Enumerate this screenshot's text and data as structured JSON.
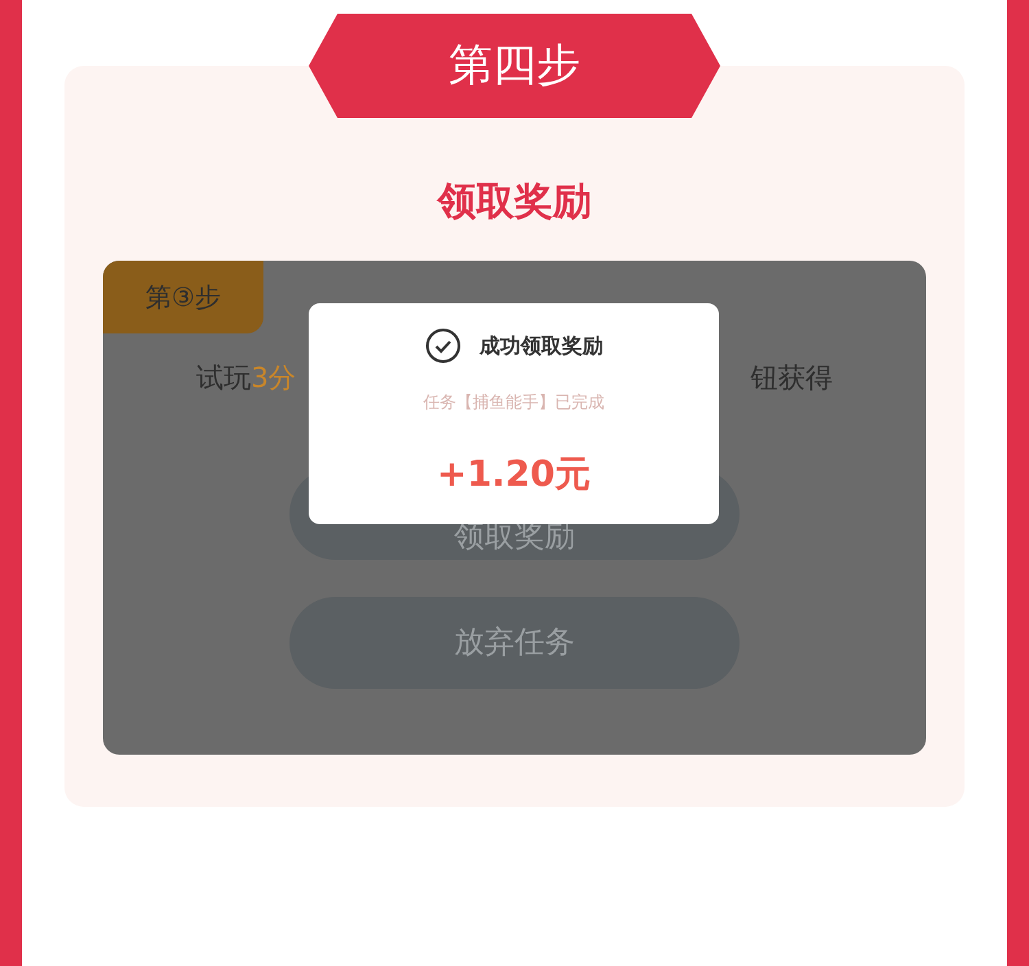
{
  "step_banner": {
    "label": "第四步"
  },
  "section_title": "领取奖励",
  "task_card": {
    "dimmed": true,
    "step_badge": "第③步",
    "instruction": {
      "prefix": "试玩",
      "highlight": "3分",
      "suffix": "钮获得"
    },
    "buttons": [
      "领取奖励",
      "放弃任务"
    ]
  },
  "dialog": {
    "title": "成功领取奖励",
    "message": "任务【捕鱼能手】已完成",
    "amount": "+1.20元"
  }
}
